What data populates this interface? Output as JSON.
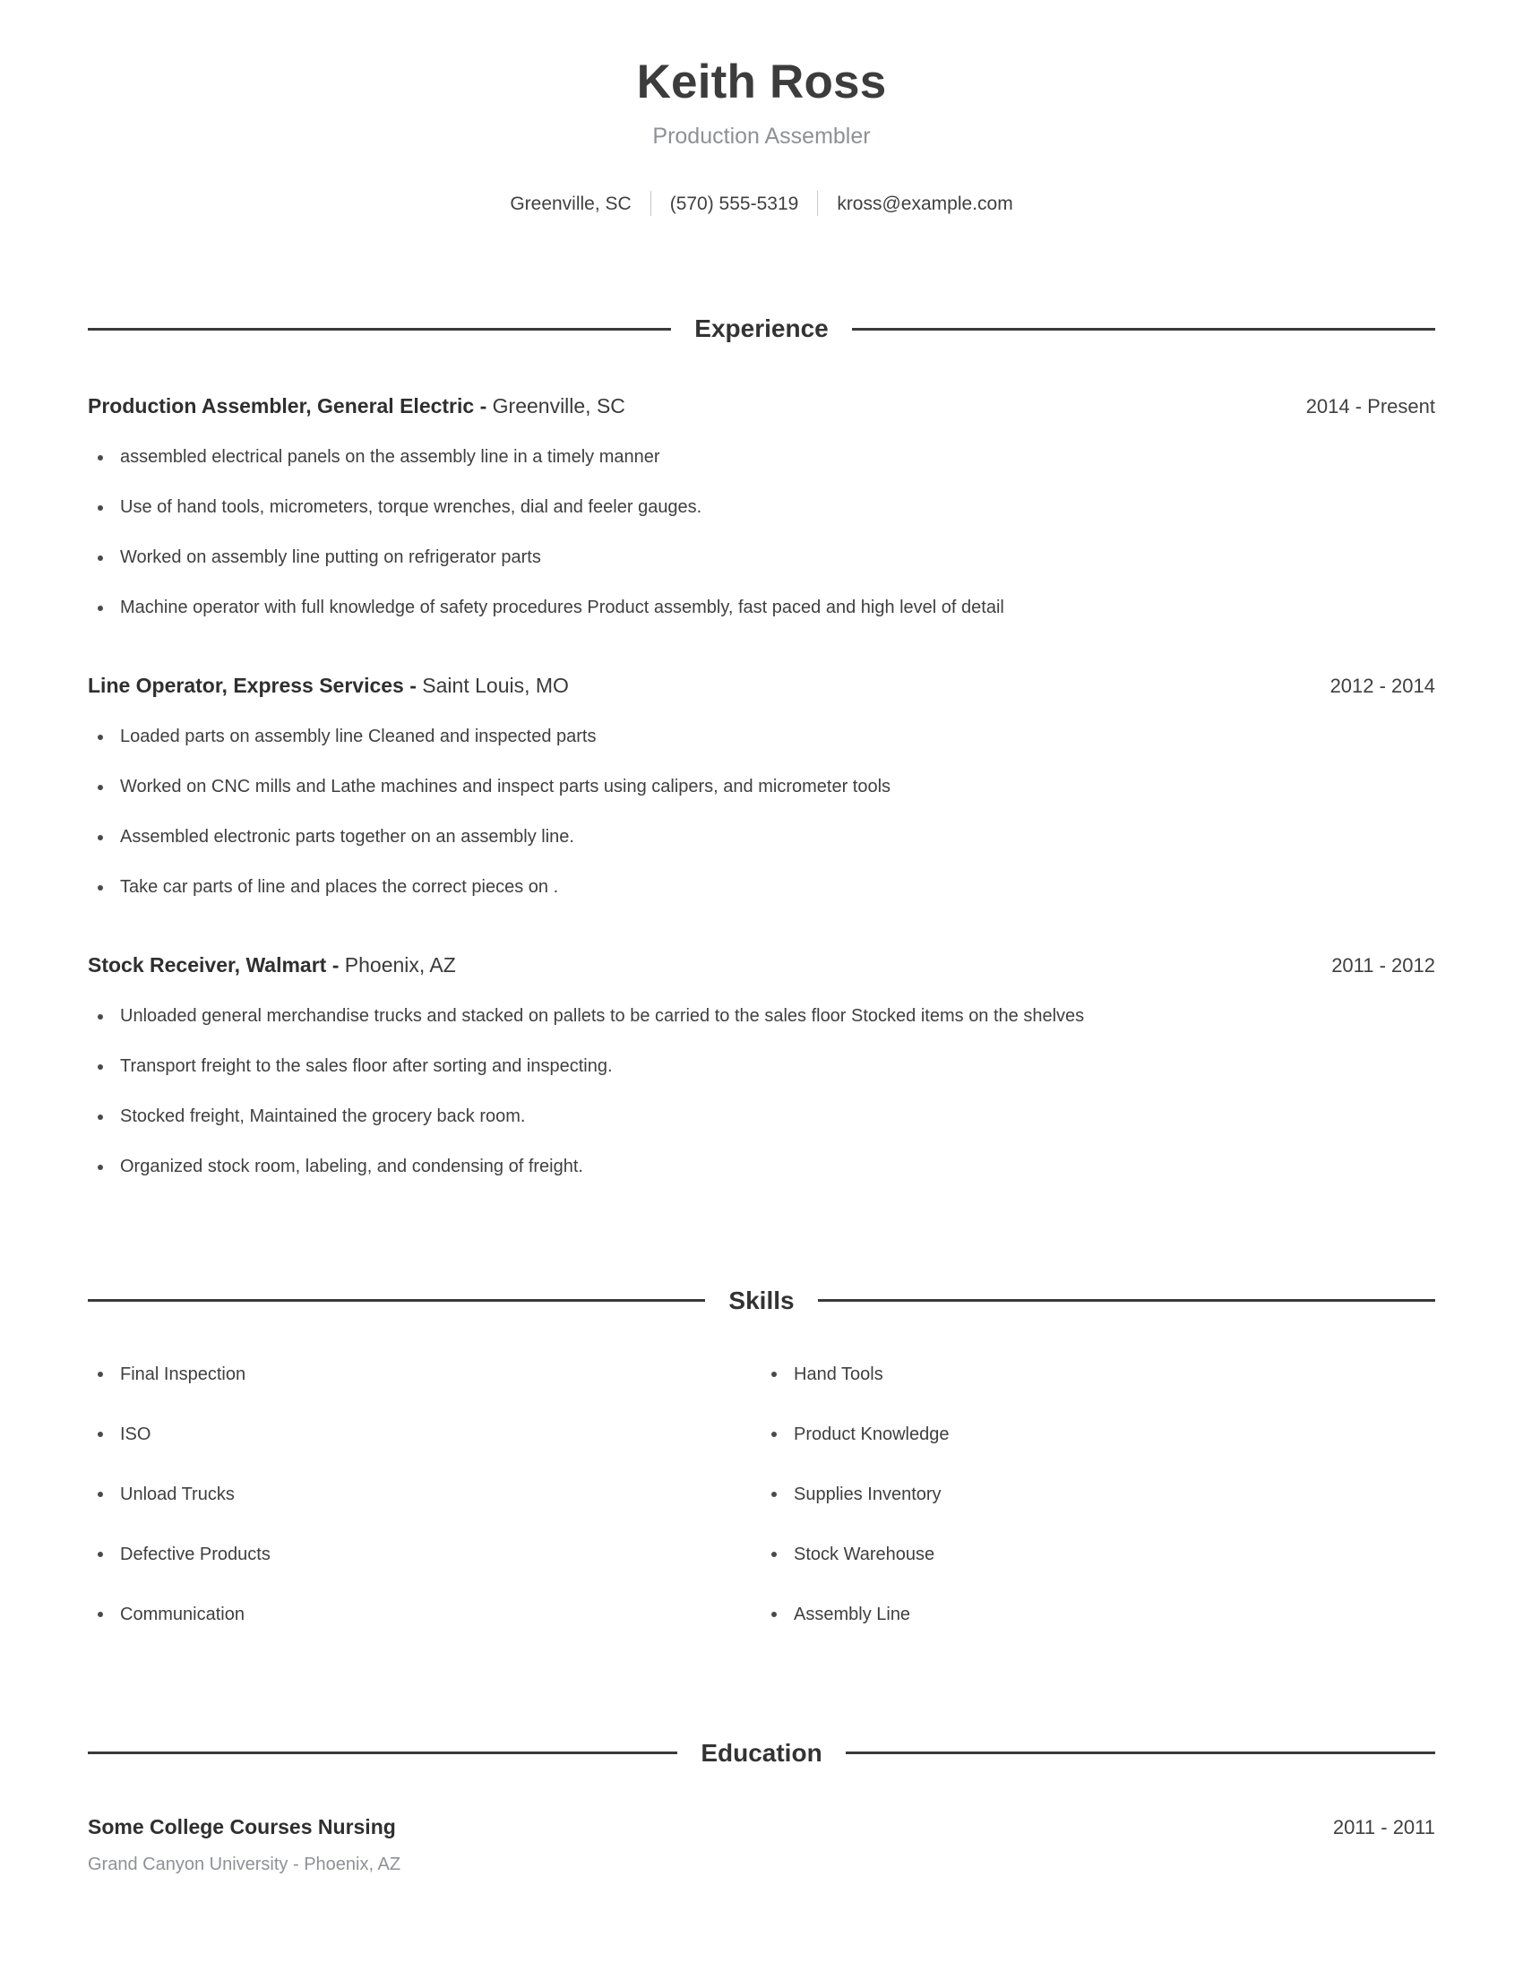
{
  "header": {
    "name": "Keith Ross",
    "subtitle": "Production Assembler",
    "contact": {
      "location": "Greenville, SC",
      "phone": "(570) 555-5319",
      "email": "kross@example.com"
    }
  },
  "sections": {
    "experience": {
      "title": "Experience",
      "entries": [
        {
          "role_company": "Production Assembler, General Electric -",
          "location": "Greenville, SC",
          "date": "2014 - Present",
          "bullets": [
            "assembled electrical panels on the assembly line in a timely manner",
            "Use of hand tools, micrometers, torque wrenches, dial and feeler gauges.",
            "Worked on assembly line putting on refrigerator parts",
            "Machine operator with full knowledge of safety procedures Product assembly, fast paced and high level of detail"
          ]
        },
        {
          "role_company": "Line Operator, Express Services -",
          "location": "Saint Louis, MO",
          "date": "2012 - 2014",
          "bullets": [
            "Loaded parts on assembly line Cleaned and inspected parts",
            "Worked on CNC mills and Lathe machines and inspect parts using calipers, and micrometer tools",
            "Assembled electronic parts together on an assembly line.",
            "Take car parts of line and places the correct pieces on ."
          ]
        },
        {
          "role_company": "Stock Receiver, Walmart -",
          "location": "Phoenix, AZ",
          "date": "2011 - 2012",
          "bullets": [
            "Unloaded general merchandise trucks and stacked on pallets to be carried to the sales floor Stocked items on the shelves",
            "Transport freight to the sales floor after sorting and inspecting.",
            "Stocked freight, Maintained the grocery back room.",
            "Organized stock room, labeling, and condensing of freight."
          ]
        }
      ]
    },
    "skills": {
      "title": "Skills",
      "column_left": [
        "Final Inspection",
        "ISO",
        "Unload Trucks",
        "Defective Products",
        "Communication"
      ],
      "column_right": [
        "Hand Tools",
        "Product Knowledge",
        "Supplies Inventory",
        "Stock Warehouse",
        "Assembly Line"
      ]
    },
    "education": {
      "title": "Education",
      "entries": [
        {
          "degree": "Some College Courses Nursing",
          "school": "Grand Canyon University - Phoenix, AZ",
          "date": "2011 - 2011"
        }
      ]
    }
  }
}
